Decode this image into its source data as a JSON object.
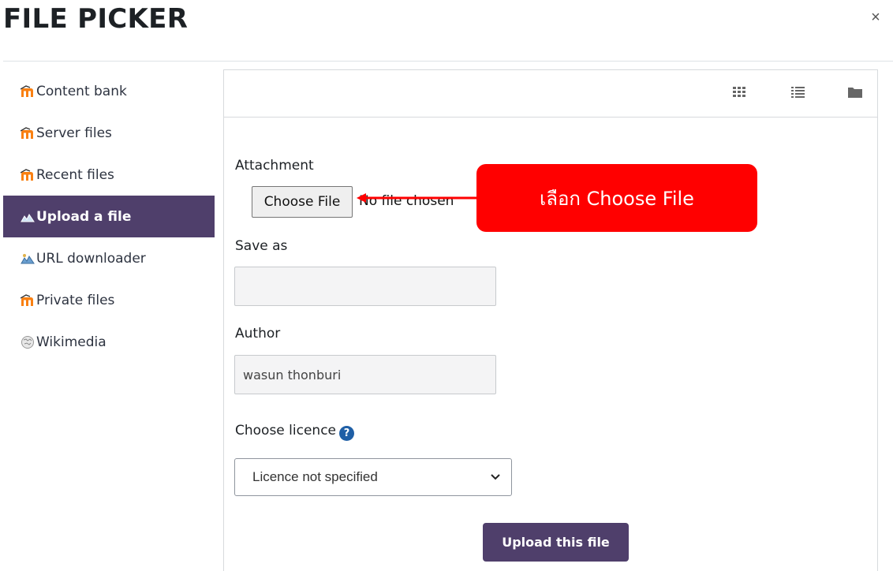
{
  "dialog": {
    "title": "FILE PICKER",
    "close_label": "×"
  },
  "sidebar": {
    "items": [
      {
        "label": "Content bank",
        "icon": "moodle-icon",
        "active": false
      },
      {
        "label": "Server files",
        "icon": "moodle-icon",
        "active": false
      },
      {
        "label": "Recent files",
        "icon": "moodle-icon",
        "active": false
      },
      {
        "label": "Upload a file",
        "icon": "upload-icon",
        "active": true
      },
      {
        "label": "URL downloader",
        "icon": "url-downloader-icon",
        "active": false
      },
      {
        "label": "Private files",
        "icon": "moodle-icon",
        "active": false
      },
      {
        "label": "Wikimedia",
        "icon": "wikimedia-icon",
        "active": false
      }
    ]
  },
  "toolbar": {
    "icons": [
      "grid-view-icon",
      "list-view-icon",
      "folder-view-icon"
    ]
  },
  "form": {
    "attachment_label": "Attachment",
    "choose_file_label": "Choose File",
    "no_file_text": "No file chosen",
    "save_as_label": "Save as",
    "save_as_value": "",
    "author_label": "Author",
    "author_value": "wasun thonburi",
    "licence_label": "Choose licence",
    "licence_selected": "Licence not specified",
    "upload_button_label": "Upload this file"
  },
  "annotation": {
    "callout_text": "เลือก Choose File"
  },
  "colors": {
    "accent": "#4f3f6b",
    "callout": "#ff0000",
    "help_icon": "#1f5fa6",
    "moodle_orange": "#f98012"
  }
}
